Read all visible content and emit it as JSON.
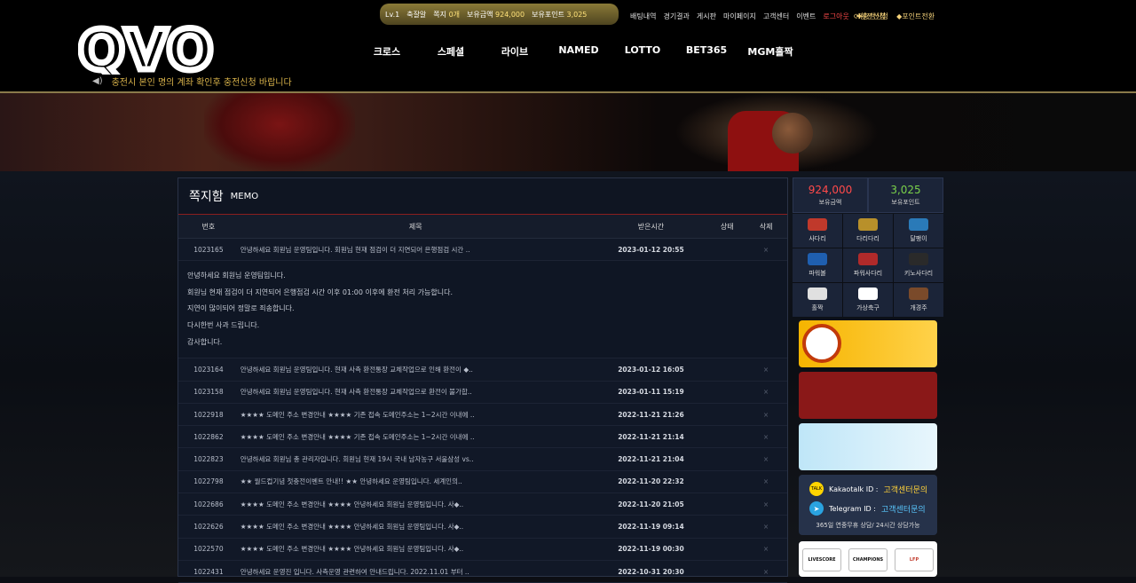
{
  "header": {
    "logo": "QVO",
    "notice": "충전시 본인 명의 계좌 확인후 충전신청 바랍니다",
    "user": {
      "level": "Lv.1",
      "name": "축잘알",
      "memo_label": "쪽지",
      "memo_count": "0개",
      "money_label": "보유금액",
      "money": "924,000",
      "point_label": "보유포인트",
      "point": "3,025"
    },
    "links": [
      "배팅내역",
      "경기결과",
      "게시판",
      "마이페이지",
      "고객센터",
      "이벤트"
    ],
    "logout": "로그아웃",
    "charge": "충전신청",
    "exchange": "환전신청",
    "point_convert": "포인트전환",
    "nav": [
      "크로스",
      "스페셜",
      "라이브",
      "NAMED",
      "LOTTO",
      "BET365",
      "MGM홀짝"
    ]
  },
  "memo": {
    "title": "쪽지함",
    "subtitle": "MEMO",
    "columns": [
      "번호",
      "제목",
      "받은시간",
      "상태",
      "삭제"
    ],
    "open_row": {
      "id": "1023165",
      "title": "안녕하세요 회원님 운영팀입니다. 회원님 현재 점검이 더 지연되어 은행점검 시간 ..",
      "time": "2023-01-12 20:55",
      "status": "",
      "del": "×"
    },
    "open_body": [
      "안녕하세요 회원님 운영팀입니다.",
      "회원님 현재 점검이 더 지연되어 은행점검 시간 이후 01:00 이후에 환전 처리 가능합니다.",
      "지연이 많이되어 정말로 죄송합니다.",
      "다시한번 사과 드립니다.",
      "감사합니다."
    ],
    "rows": [
      {
        "id": "1023164",
        "title": "안녕하세요 회원님 운영팀입니다. 현재 사측 환전통장 교체작업으로 인해 환전이 ◆..",
        "time": "2023-01-12 16:05",
        "del": "×"
      },
      {
        "id": "1023158",
        "title": "안녕하세요 회원님 운영팀입니다. 현재 사측 환전통장 교체작업으로 환전이 불가합..",
        "time": "2023-01-11 15:19",
        "del": "×"
      },
      {
        "id": "1022918",
        "title": "★★★★ 도메인 주소 변경안내 ★★★★ 기존 접속 도메인주소는 1~2시간 이내에 ..",
        "time": "2022-11-21 21:26",
        "del": "×"
      },
      {
        "id": "1022862",
        "title": "★★★★ 도메인 주소 변경안내 ★★★★ 기존 접속 도메인주소는 1~2시간 이내에 ..",
        "time": "2022-11-21 21:14",
        "del": "×"
      },
      {
        "id": "1022823",
        "title": "안녕하세요 회원님 총 관리자입니다. 회원님 현재 19시 국내 남자농구 서울삼성 vs..",
        "time": "2022-11-21 21:04",
        "del": "×"
      },
      {
        "id": "1022798",
        "title": "★★ 월드컵기념 첫충전이벤트 안내!! ★★ 안녕하세요 운영팀입니다. 세계인의..",
        "time": "2022-11-20 22:32",
        "del": "×"
      },
      {
        "id": "1022686",
        "title": "★★★★ 도메인 주소 변경안내 ★★★★ 안녕하세요 회원님 운영팀입니다. 사◆..",
        "time": "2022-11-20 21:05",
        "del": "×"
      },
      {
        "id": "1022626",
        "title": "★★★★ 도메인 주소 변경안내 ★★★★ 안녕하세요 회원님 운영팀입니다. 사◆..",
        "time": "2022-11-19 09:14",
        "del": "×"
      },
      {
        "id": "1022570",
        "title": "★★★★ 도메인 주소 변경안내 ★★★★ 안녕하세요 회원님 운영팀입니다. 사◆..",
        "time": "2022-11-19 00:30",
        "del": "×"
      },
      {
        "id": "1022431",
        "title": "안녕하세요 운영진 입니다. 사측운영 관련하여 안내드립니다. 2022.11.01 부터 ..",
        "time": "2022-10-31 20:30",
        "del": "×"
      }
    ]
  },
  "sidebar": {
    "money": "924,000",
    "money_label": "보유금액",
    "point": "3,025",
    "point_label": "보유포인트",
    "games": [
      {
        "label": "사다리",
        "color": "#c0392b"
      },
      {
        "label": "다리다리",
        "color": "#b8902a"
      },
      {
        "label": "달팽이",
        "color": "#2a7ab8"
      },
      {
        "label": "파워볼",
        "color": "#1f5fb0"
      },
      {
        "label": "파워사다리",
        "color": "#b02a2a"
      },
      {
        "label": "키노사다리",
        "color": "#2a2a2a"
      },
      {
        "label": "홀짝",
        "color": "#e0e0e0"
      },
      {
        "label": "가상축구",
        "color": "#ffffff"
      },
      {
        "label": "개경주",
        "color": "#7a4a2a"
      }
    ],
    "kakao_label": "Kakaotalk ID :",
    "kakao_value": "고객센터문의",
    "telegram_label": "Telegram ID :",
    "telegram_value": "고객센터문의",
    "support_note": "365일 연중무휴 상담/ 24시간 상담가능",
    "partners": [
      "LIVESCORE",
      "CHAMPIONS",
      "LFP"
    ]
  }
}
